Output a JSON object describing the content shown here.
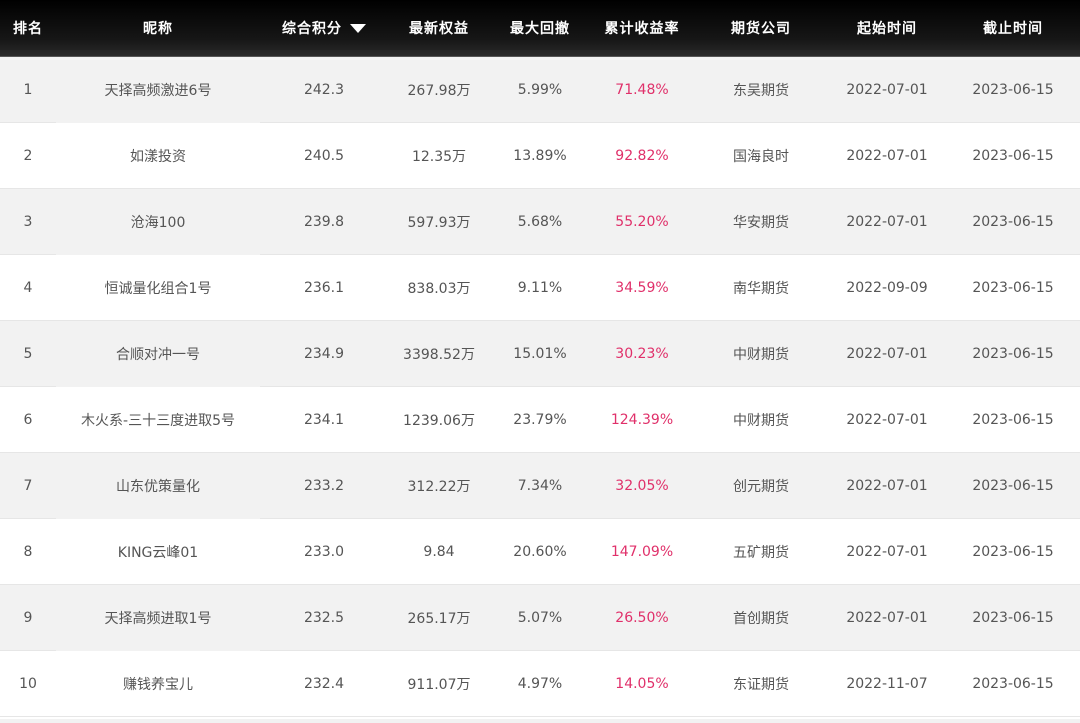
{
  "headers": {
    "rank": "排名",
    "name": "昵称",
    "score": "综合积分",
    "equity": "最新权益",
    "drawdown": "最大回撤",
    "return": "累计收益率",
    "company": "期货公司",
    "start": "起始时间",
    "end": "截止时间"
  },
  "sort_icon": "sort-descending-triangle",
  "colors": {
    "header_bg": "#000000",
    "header_text": "#ffffff",
    "row_alt_bg": "#f2f2f2",
    "text": "#555555",
    "return_text": "#e0306a"
  },
  "rows": [
    {
      "rank": "1",
      "name": "天择高频激进6号",
      "score": "242.3",
      "equity": "267.98万",
      "drawdown": "5.99%",
      "return": "71.48%",
      "company": "东吴期货",
      "start": "2022-07-01",
      "end": "2023-06-15"
    },
    {
      "rank": "2",
      "name": "如漾投资",
      "score": "240.5",
      "equity": "12.35万",
      "drawdown": "13.89%",
      "return": "92.82%",
      "company": "国海良时",
      "start": "2022-07-01",
      "end": "2023-06-15"
    },
    {
      "rank": "3",
      "name": "沧海100",
      "score": "239.8",
      "equity": "597.93万",
      "drawdown": "5.68%",
      "return": "55.20%",
      "company": "华安期货",
      "start": "2022-07-01",
      "end": "2023-06-15"
    },
    {
      "rank": "4",
      "name": "恒诚量化组合1号",
      "score": "236.1",
      "equity": "838.03万",
      "drawdown": "9.11%",
      "return": "34.59%",
      "company": "南华期货",
      "start": "2022-09-09",
      "end": "2023-06-15"
    },
    {
      "rank": "5",
      "name": "合顺对冲一号",
      "score": "234.9",
      "equity": "3398.52万",
      "drawdown": "15.01%",
      "return": "30.23%",
      "company": "中财期货",
      "start": "2022-07-01",
      "end": "2023-06-15"
    },
    {
      "rank": "6",
      "name": "木火系-三十三度进取5号",
      "score": "234.1",
      "equity": "1239.06万",
      "drawdown": "23.79%",
      "return": "124.39%",
      "company": "中财期货",
      "start": "2022-07-01",
      "end": "2023-06-15"
    },
    {
      "rank": "7",
      "name": "山东优策量化",
      "score": "233.2",
      "equity": "312.22万",
      "drawdown": "7.34%",
      "return": "32.05%",
      "company": "创元期货",
      "start": "2022-07-01",
      "end": "2023-06-15"
    },
    {
      "rank": "8",
      "name": "KING云峰01",
      "score": "233.0",
      "equity": "9.84",
      "drawdown": "20.60%",
      "return": "147.09%",
      "company": "五矿期货",
      "start": "2022-07-01",
      "end": "2023-06-15"
    },
    {
      "rank": "9",
      "name": "天择高频进取1号",
      "score": "232.5",
      "equity": "265.17万",
      "drawdown": "5.07%",
      "return": "26.50%",
      "company": "首创期货",
      "start": "2022-07-01",
      "end": "2023-06-15"
    },
    {
      "rank": "10",
      "name": "赚钱养宝儿",
      "score": "232.4",
      "equity": "911.07万",
      "drawdown": "4.97%",
      "return": "14.05%",
      "company": "东证期货",
      "start": "2022-11-07",
      "end": "2023-06-15"
    }
  ]
}
